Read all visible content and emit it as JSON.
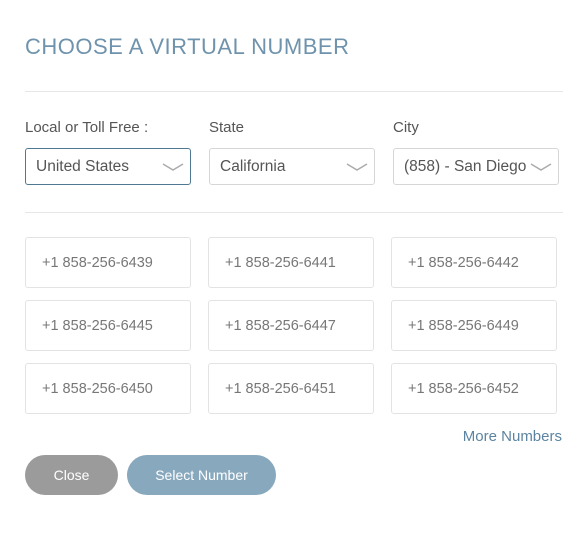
{
  "title": "CHOOSE A VIRTUAL NUMBER",
  "filters": [
    {
      "label": "Local or Toll Free :",
      "value": "United States",
      "icon": "chevron-down-icon"
    },
    {
      "label": "State",
      "value": "California",
      "icon": "chevron-down-icon"
    },
    {
      "label": "City",
      "value": "(858) - San Diego",
      "icon": "chevron-down-icon"
    }
  ],
  "numbers": [
    "+1 858-256-6439",
    "+1 858-256-6441",
    "+1 858-256-6442",
    "+1 858-256-6445",
    "+1 858-256-6447",
    "+1 858-256-6449",
    "+1 858-256-6450",
    "+1 858-256-6451",
    "+1 858-256-6452"
  ],
  "more_numbers_label": "More Numbers",
  "buttons": {
    "close": "Close",
    "select": "Select Number"
  },
  "colors": {
    "accent": "#6f93ac",
    "select_button": "#88a8bd",
    "close_button": "#9b9b9b",
    "active_border": "#4f7892"
  }
}
